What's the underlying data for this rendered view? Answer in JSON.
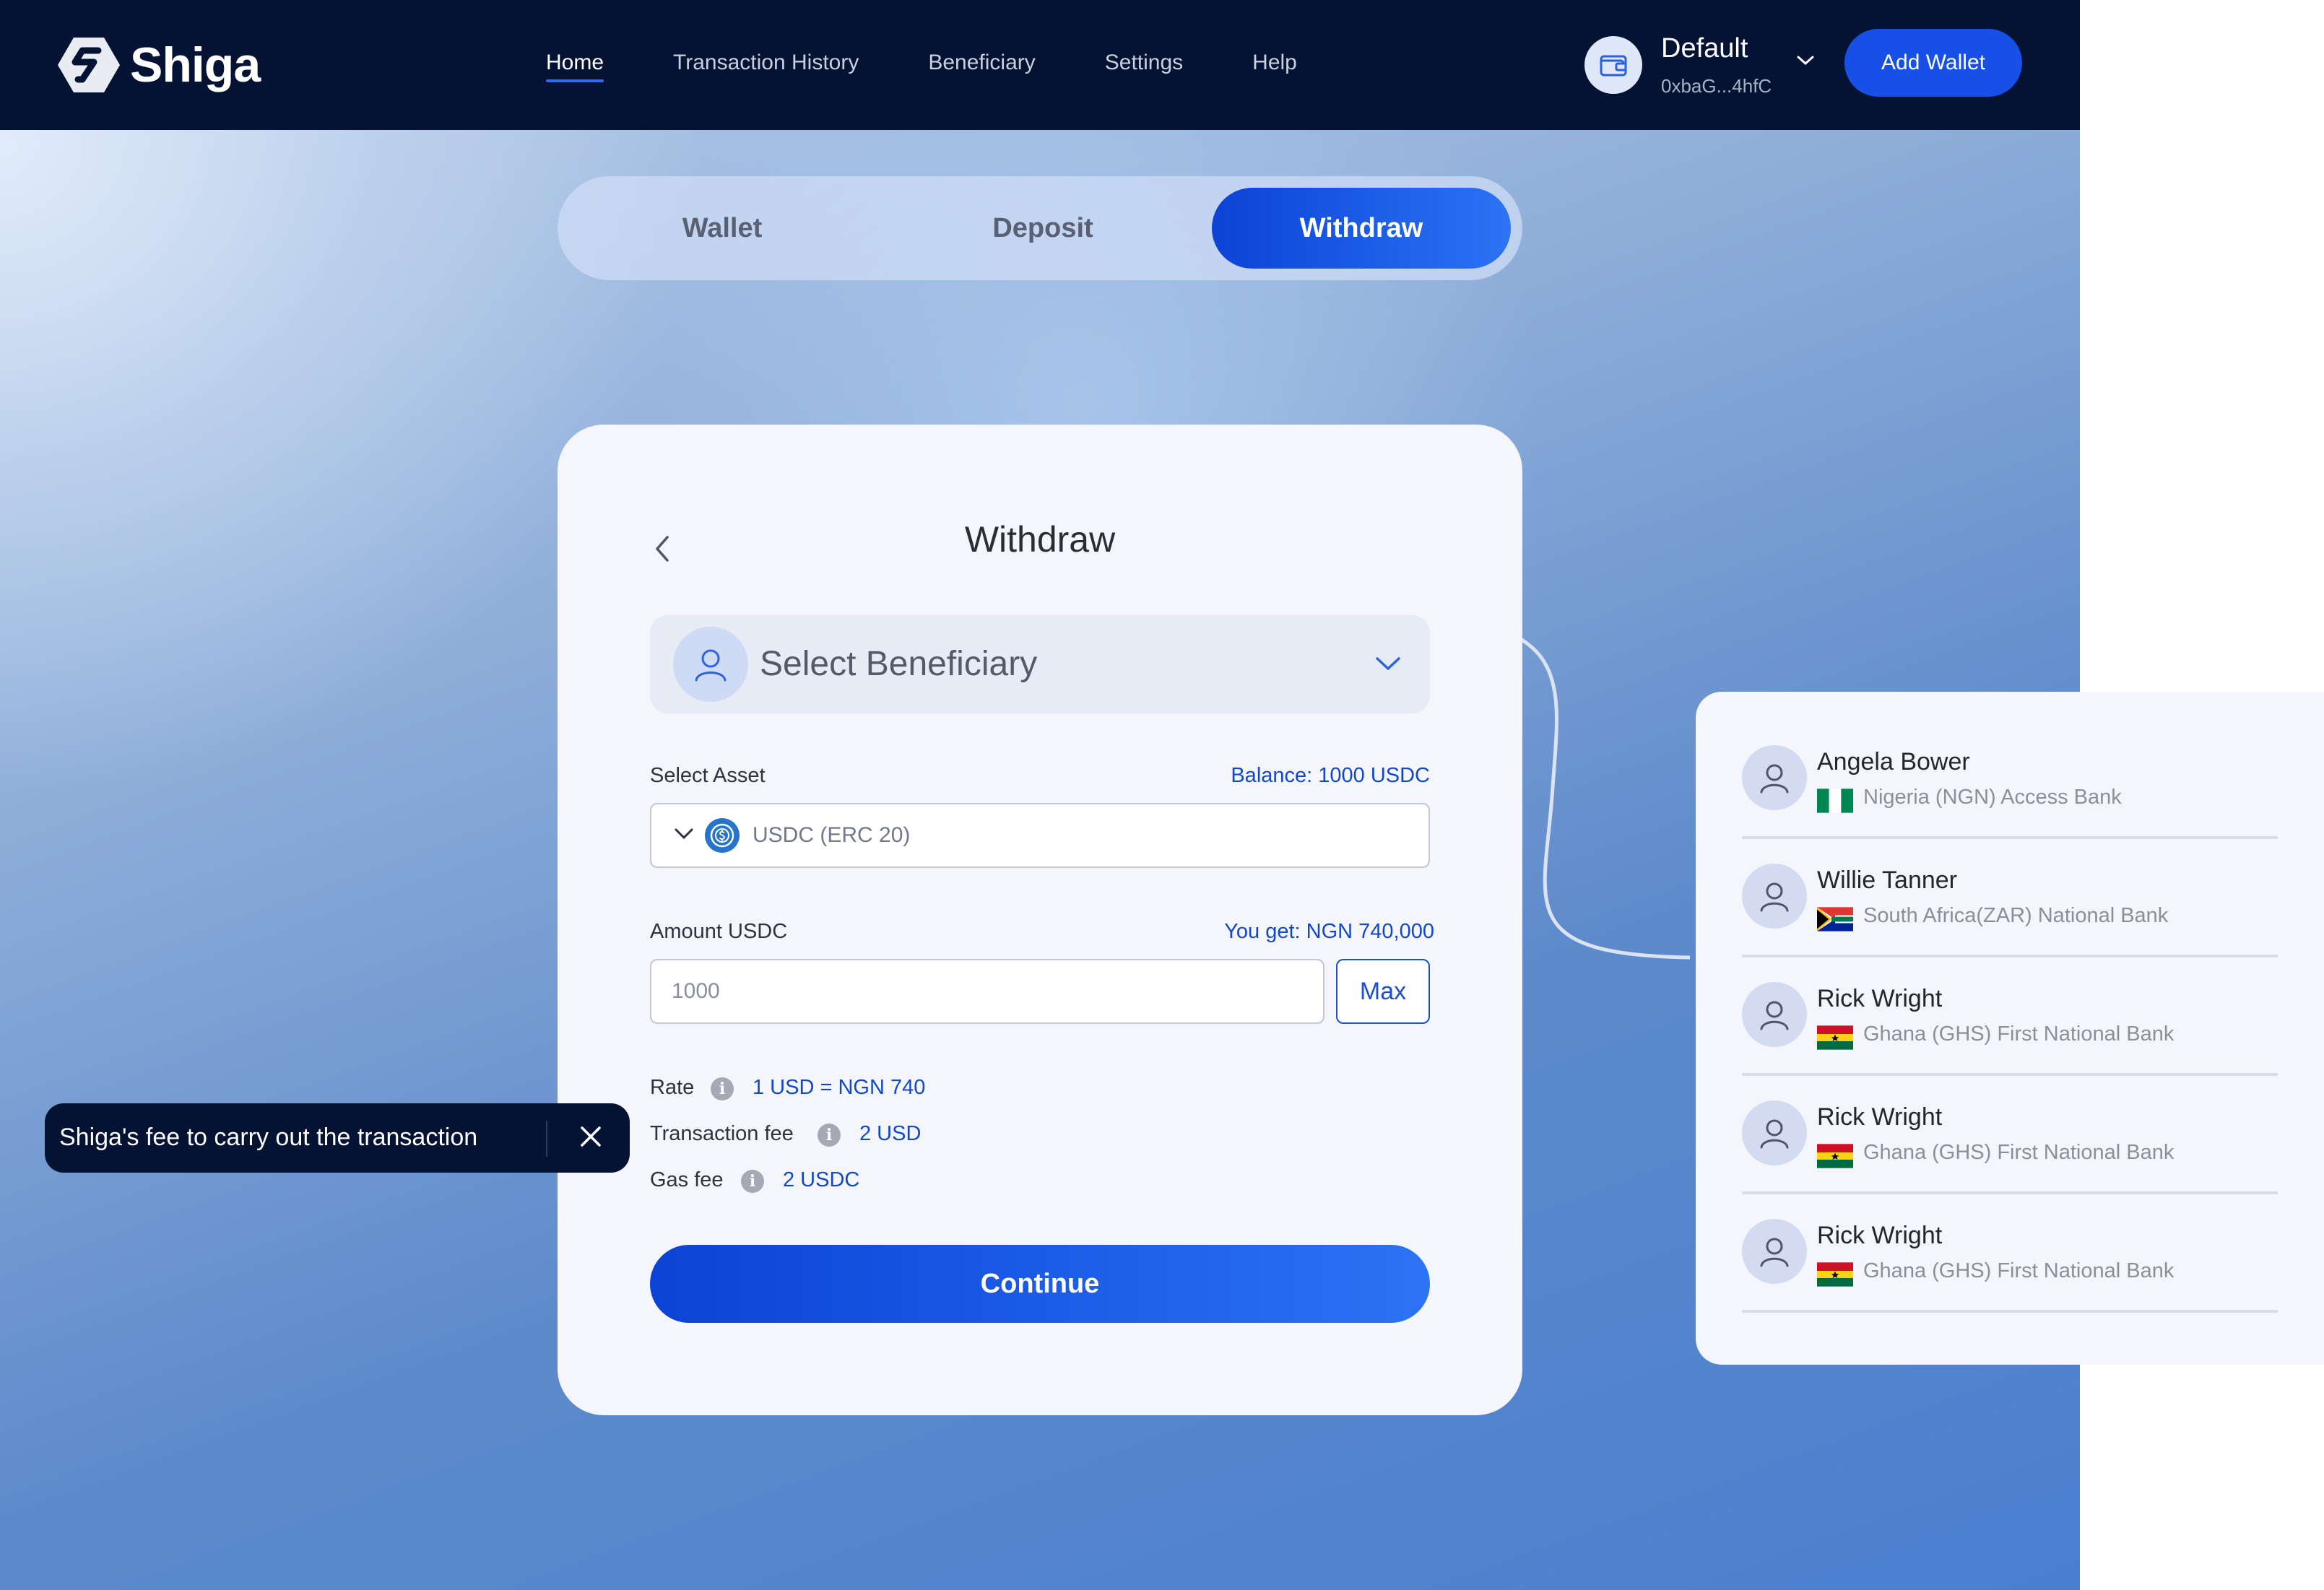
{
  "brand": {
    "name": "Shiga"
  },
  "nav": {
    "items": [
      "Home",
      "Transaction History",
      "Beneficiary",
      "Settings",
      "Help"
    ],
    "active": "Home"
  },
  "wallet": {
    "name": "Default",
    "address": "0xbaG...4hfC",
    "add_label": "Add Wallet"
  },
  "tabs": {
    "wallet": "Wallet",
    "deposit": "Deposit",
    "withdraw": "Withdraw",
    "active": "Withdraw"
  },
  "form": {
    "title": "Withdraw",
    "beneficiary_placeholder": "Select Beneficiary",
    "asset_label": "Select Asset",
    "balance": "Balance: 1000 USDC",
    "asset_value": "USDC (ERC 20)",
    "amount_label": "Amount USDC",
    "you_get": "You get: NGN 740,000",
    "amount_placeholder": "1000",
    "max_label": "Max",
    "rate_label": "Rate",
    "rate_value": "1 USD = NGN 740",
    "tx_fee_label": "Transaction fee",
    "tx_fee_value": "2 USD",
    "gas_fee_label": "Gas fee",
    "gas_fee_value": "2 USDC",
    "continue_label": "Continue"
  },
  "tooltip": {
    "text": "Shiga's fee to carry out the transaction"
  },
  "beneficiaries": [
    {
      "name": "Angela Bower",
      "bank": "Nigeria (NGN) Access Bank",
      "flag": "nigeria-flag"
    },
    {
      "name": "Willie Tanner",
      "bank": "South Africa(ZAR) National Bank",
      "flag": "south-africa-flag"
    },
    {
      "name": "Rick Wright",
      "bank": "Ghana (GHS) First National Bank",
      "flag": "ghana-flag"
    },
    {
      "name": "Rick Wright",
      "bank": "Ghana (GHS) First National Bank",
      "flag": "ghana-flag"
    },
    {
      "name": "Rick Wright",
      "bank": "Ghana (GHS) First National Bank",
      "flag": "ghana-flag"
    }
  ],
  "colors": {
    "navbar": "#041233",
    "primary": "#1650e6",
    "link_blue": "#1248c8",
    "card": "#f4f6fb"
  }
}
